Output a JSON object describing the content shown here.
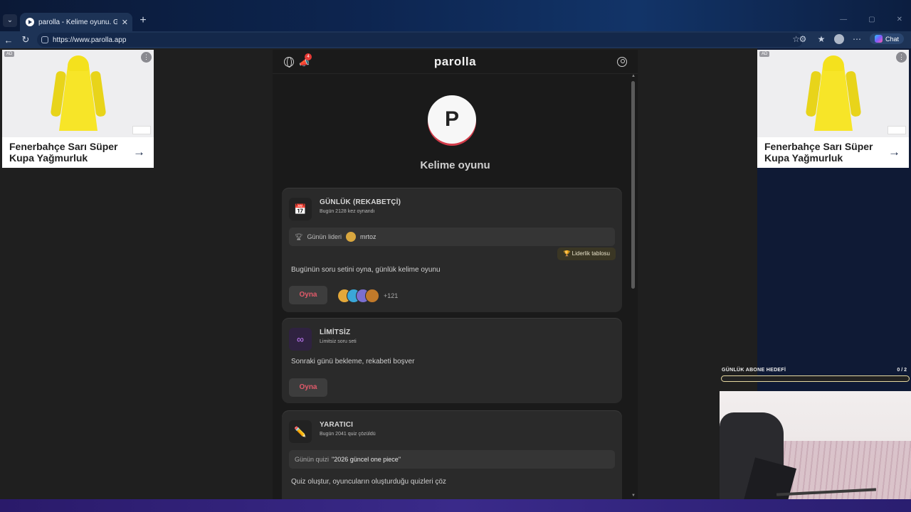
{
  "browser": {
    "tab_title": "parolla - Kelime oyunu. Günlük ke",
    "url": "https://www.parolla.app",
    "chat_label": "Chat"
  },
  "ads": [
    {
      "badge": "AD",
      "title": "Fenerbahçe Sarı Süper Kupa Yağmurluk"
    },
    {
      "badge": "AD",
      "title": "Fenerbahçe Sarı Süper Kupa Yağmurluk"
    }
  ],
  "app": {
    "logo": "parolla",
    "notification_count": "4",
    "avatar_letter": "P",
    "page_title": "Kelime oyunu"
  },
  "cards": {
    "daily": {
      "title": "GÜNLÜK (REKABETÇİ)",
      "subtitle": "Bugün 2128 kez oynandı",
      "leader_label": "Günün lideri",
      "leader_name": "mrtoz",
      "leaderboard_button": "🏆 Liderlik tablosu",
      "description": "Bugünün soru setini oyna, günlük kelime oyunu",
      "play_label": "Oyna",
      "extra_players": "+121"
    },
    "unlimited": {
      "title": "LİMİTSİZ",
      "subtitle": "Limitsiz soru seti",
      "description": "Sonraki günü bekleme, rekabeti boşver",
      "play_label": "Oyna"
    },
    "creator": {
      "title": "YARATICI",
      "subtitle": "Bugün 2041 quiz çözüldü",
      "quiz_label": "Günün quizi",
      "quiz_name": "\"2026 güncel one piece\"",
      "description": "Quiz oluştur, oyuncuların oluşturduğu quizleri çöz"
    }
  },
  "stream": {
    "goal_label": "GÜNLÜK ABONE HEDEFİ",
    "goal_count": "0 / 2",
    "goal_progress": 0
  },
  "colors": {
    "accent": "#e25a6a",
    "card_bg": "#2a2a2a",
    "panel_bg": "#1a1a1a"
  }
}
